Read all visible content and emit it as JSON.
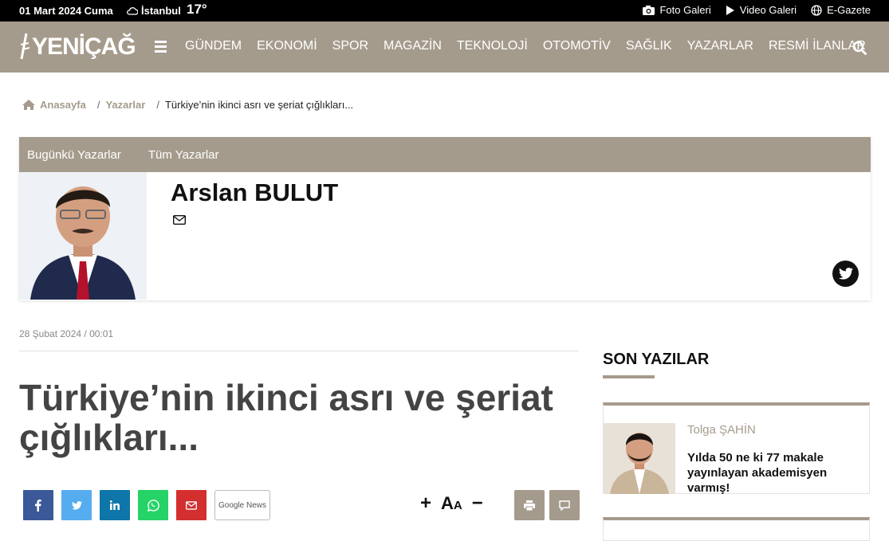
{
  "topbar": {
    "date": "01 Mart 2024 Cuma",
    "city": "İstanbul",
    "temp": "17°",
    "links": [
      {
        "label": "Foto Galeri",
        "icon": "camera-icon"
      },
      {
        "label": "Video Galeri",
        "icon": "play-icon"
      },
      {
        "label": "E-Gazete",
        "icon": "globe-icon"
      }
    ]
  },
  "nav": {
    "logo": "YENİÇAĞ",
    "menu": [
      "GÜNDEM",
      "EKONOMİ",
      "SPOR",
      "MAGAZİN",
      "TEKNOLOJİ",
      "OTOMOTİV",
      "SAĞLIK",
      "YAZARLAR",
      "RESMİ İLANLAR"
    ]
  },
  "breadcrumb": {
    "home": "Anasayfa",
    "section": "Yazarlar",
    "current": "Türkiye’nin ikinci asrı ve şeriat çığlıkları..."
  },
  "author_box": {
    "tabs": [
      "Bugünkü Yazarlar",
      "Tüm Yazarlar"
    ],
    "name": "Arslan BULUT"
  },
  "article": {
    "date": "28 Şubat 2024 / 00:01",
    "title": "Türkiye’nin ikinci asrı ve şeriat çığlıkları...",
    "google_news": "Google News",
    "font_plus": "+",
    "font_label_big": "A",
    "font_label_small": "A",
    "font_minus": "−"
  },
  "sidebar": {
    "title": "SON YAZILAR",
    "cards": [
      {
        "writer": "Tolga ŞAHİN",
        "title": "Yılda 50 ne ki 77 makale yayınlayan akademisyen varmış!"
      }
    ]
  },
  "colors": {
    "brand": "#a59b8c",
    "facebook": "#3b5998",
    "twitter": "#55acee",
    "linkedin": "#0e76a8",
    "whatsapp": "#25d366",
    "email": "#d32f2f"
  }
}
